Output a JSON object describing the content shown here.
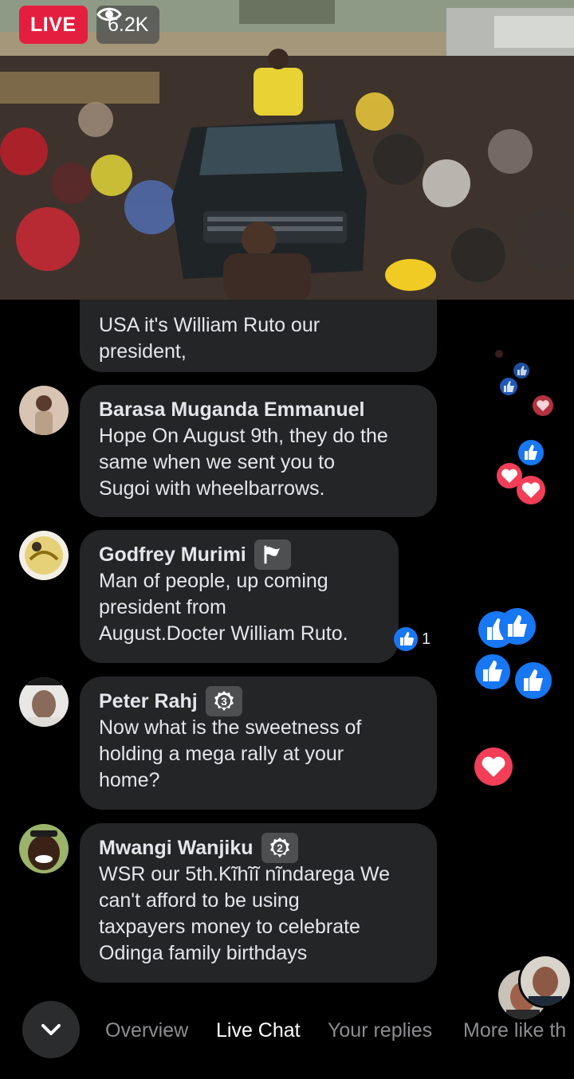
{
  "live": {
    "badge": "LIVE",
    "viewers": "6.2K",
    "icon": "eye-icon"
  },
  "colors": {
    "live_red": "#e41e3f",
    "bubble_bg": "#242526",
    "like_blue": "#1877f2",
    "love_red": "#f33e58",
    "active_tab": "#ffffff",
    "inactive_tab": "#8c8d90"
  },
  "comments": [
    {
      "author": "",
      "text": "USA it's William Ruto our\npresident,",
      "flair": ""
    },
    {
      "author": "Barasa Muganda Emmanuel",
      "text": "Hope On August 9th, they do the\nsame when we sent you to\nSugoi with wheelbarrows.",
      "flair": ""
    },
    {
      "author": "Godfrey Murimi",
      "text": "Man of people, up coming\npresident from\nAugust.Docter William Ruto.",
      "flair": "flag-icon",
      "reaction_count": "1"
    },
    {
      "author": "Peter Rahj",
      "text": "Now what is the sweetness of\nholding a mega rally at your\nhome?",
      "flair": "3"
    },
    {
      "author": "Mwangi Wanjiku",
      "text": "WSR our 5th.Kĩhĩĩ nĩndarega We\ncan't afford to be using\ntaxpayers money to celebrate\nOdinga family birthdays",
      "flair": "2"
    }
  ],
  "tabs": [
    {
      "label": "Overview",
      "active": false
    },
    {
      "label": "Live Chat",
      "active": true
    },
    {
      "label": "Your replies",
      "active": false
    },
    {
      "label": "More like th",
      "active": false
    }
  ],
  "nav_icon": "chevron-down-icon"
}
